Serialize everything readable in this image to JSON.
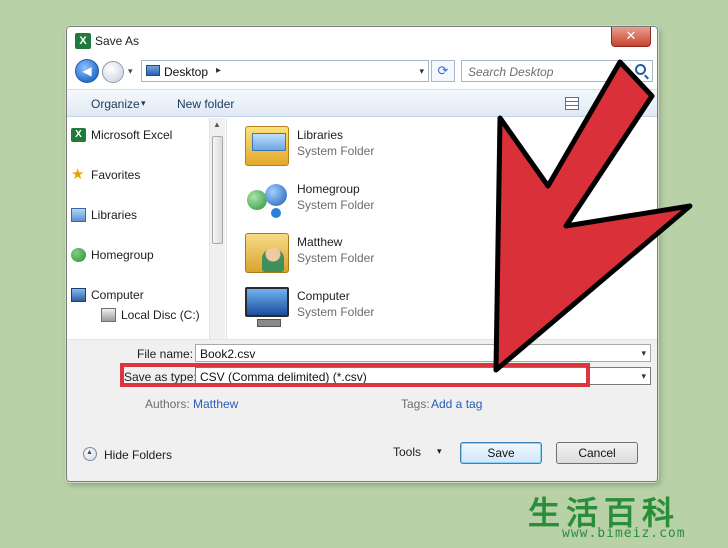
{
  "window": {
    "title": "Save As",
    "close_glyph": "✕",
    "app_icon": "X"
  },
  "navbar": {
    "back_glyph": "◀",
    "address": "Desktop",
    "address_caret": "▸",
    "dropdown_glyph": "▾",
    "refresh_glyph": "⟳",
    "search_placeholder": "Search Desktop"
  },
  "toolbar": {
    "organize_label": "Organize",
    "organize_caret": "▾",
    "new_folder_label": "New folder"
  },
  "sidebar": {
    "items": [
      {
        "label": "Microsoft Excel",
        "icon": "excel-icon"
      },
      {
        "label": "Favorites",
        "icon": "star-icon"
      },
      {
        "label": "Libraries",
        "icon": "libraries-icon"
      },
      {
        "label": "Homegroup",
        "icon": "homegroup-icon"
      },
      {
        "label": "Computer",
        "icon": "computer-icon"
      },
      {
        "label": "Local Disc (C:)",
        "icon": "disk-icon"
      }
    ],
    "excel_glyph": "X",
    "star_glyph": "★"
  },
  "files": [
    {
      "name": "Libraries",
      "type": "System Folder",
      "icon": "libraries-folder-icon"
    },
    {
      "name": "Homegroup",
      "type": "System Folder",
      "icon": "homegroup-icon"
    },
    {
      "name": "Matthew",
      "type": "System Folder",
      "icon": "user-folder-icon"
    },
    {
      "name": "Computer",
      "type": "System Folder",
      "icon": "computer-icon"
    }
  ],
  "scroll": {
    "up_glyph": "▲",
    "down_glyph": "▼"
  },
  "form": {
    "file_name_label": "File name:",
    "file_name_value": "Book2.csv",
    "save_type_label": "Save as type:",
    "save_type_value": "CSV (Comma delimited) (*.csv)",
    "authors_label": "Authors:",
    "authors_value": "Matthew",
    "tags_label": "Tags:",
    "tags_value": "Add a tag",
    "dropdown_glyph": "▾"
  },
  "footer": {
    "hide_folders_label": "Hide Folders",
    "tools_label": "Tools",
    "tools_caret": "▾",
    "save_label": "Save",
    "cancel_label": "Cancel"
  },
  "annotation": {
    "arrow_color": "#d9303a",
    "highlight_color": "#d9363e"
  },
  "watermark": {
    "chars": "生活百科",
    "url": "www.bimeiz.com"
  }
}
